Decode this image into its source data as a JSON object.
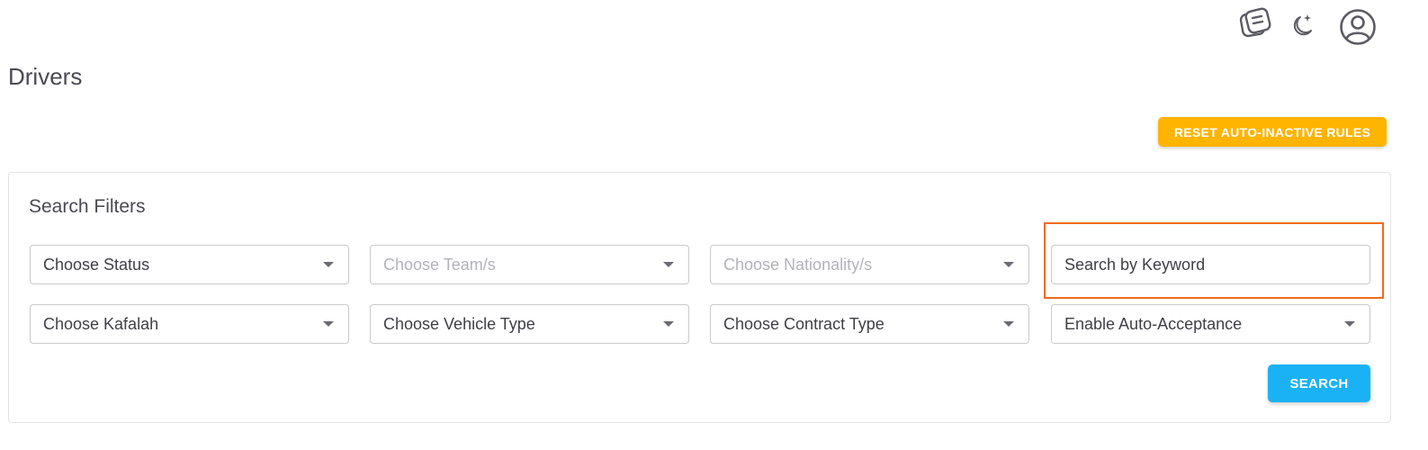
{
  "header": {
    "notes_icon": "notes-icon",
    "theme_icon": "moon-stars-icon",
    "avatar_icon": "user-circle-icon"
  },
  "page": {
    "title": "Drivers"
  },
  "actions": {
    "reset_auto_inactive_label": "RESET AUTO-INACTIVE RULES",
    "reset_color": "#ffb400"
  },
  "filters": {
    "title": "Search Filters",
    "status": "Choose Status",
    "teams": "Choose Team/s",
    "nationalities": "Choose Nationality/s",
    "keyword_placeholder": "Search by Keyword",
    "kafalah": "Choose Kafalah",
    "vehicle_type": "Choose Vehicle Type",
    "contract_type": "Choose Contract Type",
    "auto_acceptance": "Enable Auto-Acceptance",
    "search_label": "SEARCH",
    "search_color": "#1ab2f5",
    "highlight_color": "#f26b1d"
  }
}
